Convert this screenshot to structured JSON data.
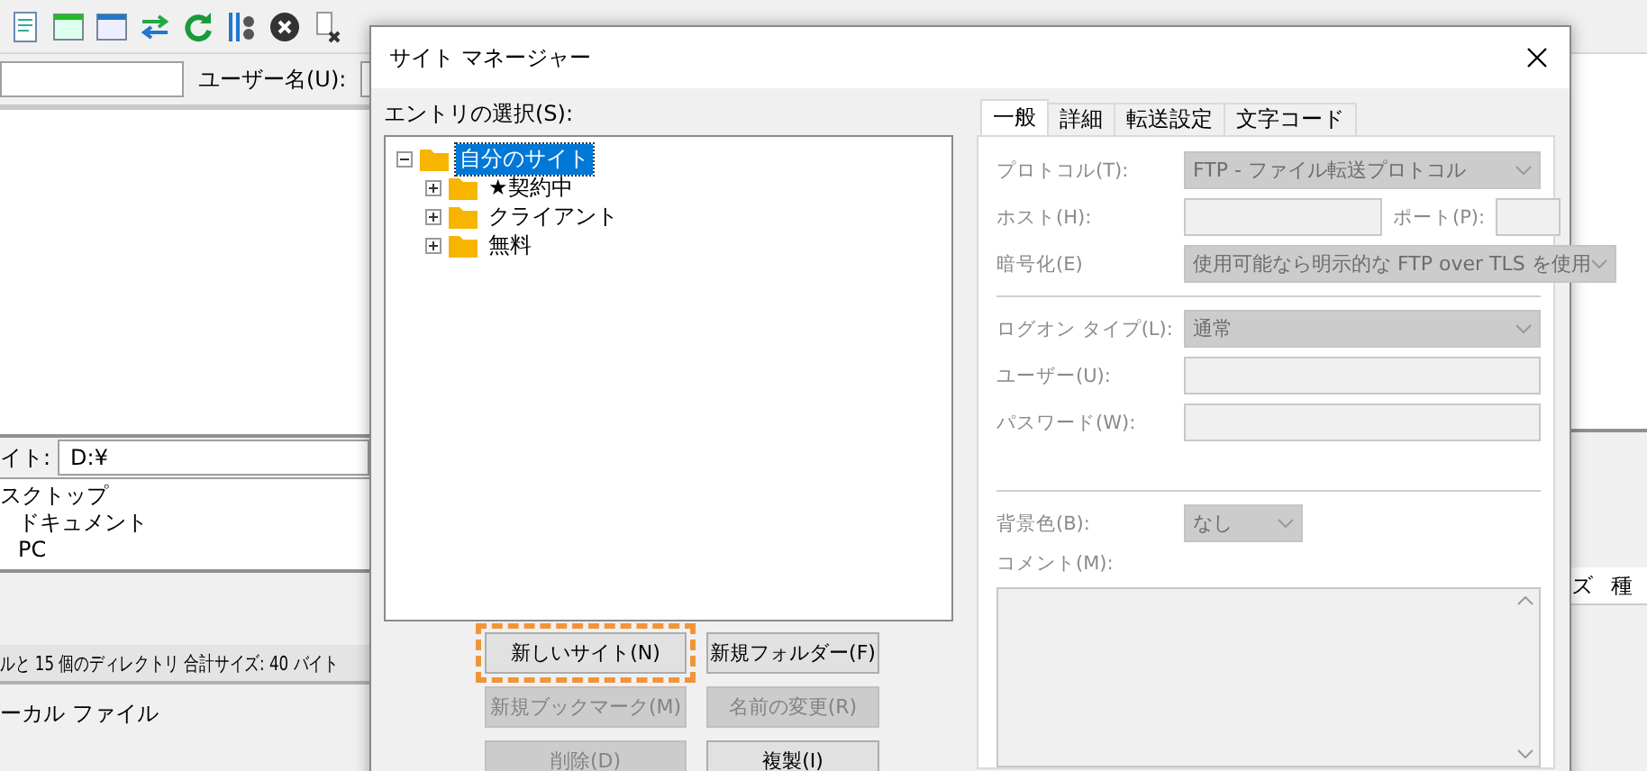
{
  "quickconnect": {
    "user_label": "ユーザー名(U):"
  },
  "local_panel": {
    "site_label": "イト:",
    "path": "D:¥",
    "tree": [
      "スクトップ",
      "ドキュメント",
      "PC"
    ],
    "status": "ルと 15 個のディレクトリ 合計サイズ: 40 バイト",
    "list_title": "ーカル ファイル"
  },
  "remote_columns": [
    "ズ",
    "種"
  ],
  "dialog": {
    "title": "サイト マネージャー",
    "entry_label": "エントリの選択(S):",
    "tree": [
      {
        "label": "自分のサイト",
        "selected": true,
        "expanded": true,
        "children": [
          {
            "label": "★契約中",
            "selected": false,
            "expanded": false
          },
          {
            "label": "クライアント",
            "selected": false,
            "expanded": false
          },
          {
            "label": "無料",
            "selected": false,
            "expanded": false
          }
        ]
      }
    ],
    "buttons": [
      {
        "label": "新しいサイト(N)",
        "disabled": false,
        "highlighted": true
      },
      {
        "label": "新規フォルダー(F)",
        "disabled": false,
        "highlighted": false
      },
      {
        "label": "新規ブックマーク(M)",
        "disabled": true,
        "highlighted": false
      },
      {
        "label": "名前の変更(R)",
        "disabled": true,
        "highlighted": false
      },
      {
        "label": "削除(D)",
        "disabled": true,
        "highlighted": false
      },
      {
        "label": "複製(I)",
        "disabled": false,
        "highlighted": false
      }
    ],
    "tabs": [
      {
        "label": "一般",
        "selected": true
      },
      {
        "label": "詳細",
        "selected": false
      },
      {
        "label": "転送設定",
        "selected": false
      },
      {
        "label": "文字コード",
        "selected": false
      }
    ],
    "fields": [
      {
        "kind": "select",
        "label": "プロトコル(T):",
        "value": "FTP - ファイル転送プロトコル",
        "disabled": true
      },
      {
        "kind": "hostport",
        "label": "ホスト(H):",
        "port_label": "ポート(P):",
        "disabled": true
      },
      {
        "kind": "select",
        "label": "暗号化(E)",
        "value": "使用可能なら明示的な FTP over TLS を使用",
        "disabled": true
      },
      {
        "kind": "separator"
      },
      {
        "kind": "select",
        "label": "ログオン タイプ(L):",
        "value": "通常",
        "disabled": true
      },
      {
        "kind": "text",
        "label": "ユーザー(U):",
        "disabled": true
      },
      {
        "kind": "text",
        "label": "パスワード(W):",
        "disabled": true
      },
      {
        "kind": "gap"
      },
      {
        "kind": "separator"
      },
      {
        "kind": "smallselect",
        "label": "背景色(B):",
        "value": "なし",
        "disabled": true
      },
      {
        "kind": "textarea",
        "label": "コメント(M):",
        "disabled": true
      }
    ]
  }
}
